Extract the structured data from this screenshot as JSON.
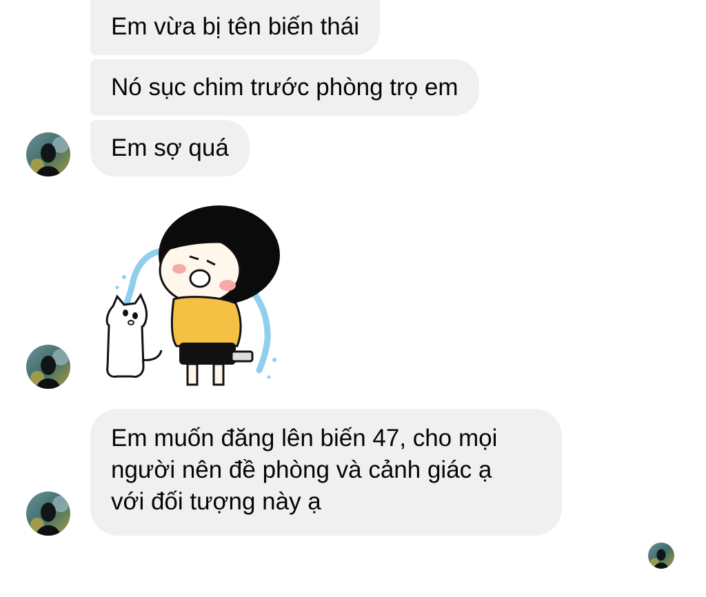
{
  "messages": [
    {
      "text": "Em vừa bị tên biến thái"
    },
    {
      "text": "Nó sục chim trước phòng trọ em"
    },
    {
      "text": "Em sợ quá"
    },
    {
      "sticker": "crying-girl-and-cat-sticker"
    },
    {
      "lines": [
        "Em muốn đăng lên biến 47, cho mọi",
        "người nên đề phòng và cảnh giác ạ",
        "với đối tượng này ạ"
      ]
    }
  ],
  "colors": {
    "bubble": "#f0f0f0",
    "text": "#050505",
    "background": "#ffffff"
  },
  "icons": {
    "avatar": "contact-avatar",
    "seen": "seen-receipt-avatar"
  }
}
